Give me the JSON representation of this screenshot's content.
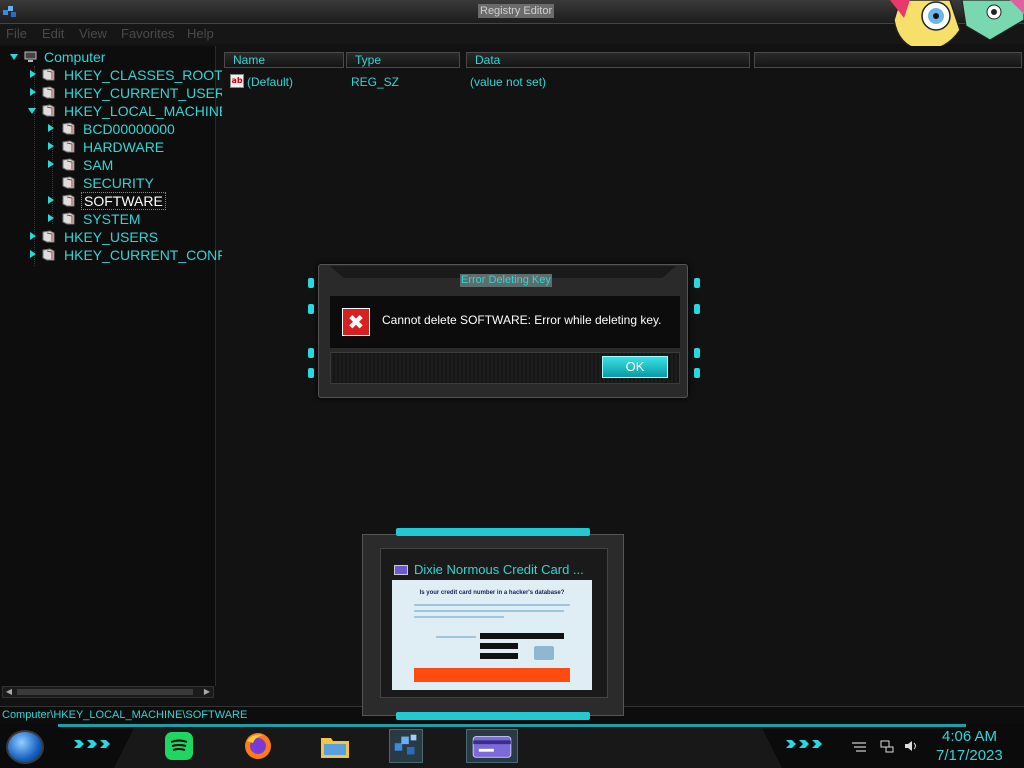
{
  "window": {
    "title": "Registry Editor",
    "menu": [
      "File",
      "Edit",
      "View",
      "Favorites",
      "Help"
    ]
  },
  "tree": {
    "root": "Computer",
    "items": [
      {
        "label": "HKEY_CLASSES_ROOT",
        "level": 1
      },
      {
        "label": "HKEY_CURRENT_USER",
        "level": 1
      },
      {
        "label": "HKEY_LOCAL_MACHINE",
        "level": 1
      },
      {
        "label": "BCD00000000",
        "level": 2
      },
      {
        "label": "HARDWARE",
        "level": 2
      },
      {
        "label": "SAM",
        "level": 2
      },
      {
        "label": "SECURITY",
        "level": 2
      },
      {
        "label": "SOFTWARE",
        "level": 2
      },
      {
        "label": "SYSTEM",
        "level": 2
      },
      {
        "label": "HKEY_USERS",
        "level": 1
      },
      {
        "label": "HKEY_CURRENT_CONFI",
        "level": 1
      }
    ],
    "selected": "SOFTWARE"
  },
  "list": {
    "columns": [
      "Name",
      "Type",
      "Data"
    ],
    "rows": [
      {
        "icon": "string-value-icon",
        "icon_text": "ab",
        "name": "(Default)",
        "type": "REG_SZ",
        "data": "(value not set)"
      }
    ]
  },
  "dialog": {
    "title": "Error Deleting Key",
    "message": "Cannot delete SOFTWARE:  Error while deleting key.",
    "icon_glyph": "✖",
    "ok_label": "OK"
  },
  "status_bar": {
    "path": "Computer\\HKEY_LOCAL_MACHINE\\SOFTWARE"
  },
  "thumbnail": {
    "title": "Dixie Normous Credit Card ...",
    "page_heading": "Is your credit card number in a hacker's database?"
  },
  "taskbar": {
    "clock_time": "4:06 AM",
    "clock_date": "7/17/2023",
    "apps": [
      "spotify-icon",
      "firefox-icon",
      "file-explorer-icon",
      "registry-editor-icon",
      "credit-card-app-icon"
    ]
  },
  "colors": {
    "accent": "#2fd6d6",
    "error": "#d82020",
    "cta": "#ff4a10"
  }
}
